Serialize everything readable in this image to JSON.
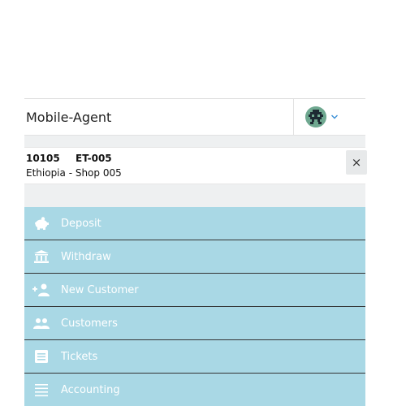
{
  "header": {
    "title": "Mobile-Agent"
  },
  "shop": {
    "code": "10105",
    "id": "ET-005",
    "name": "Ethiopia - Shop 005",
    "close_label": "×"
  },
  "menu": {
    "items": [
      {
        "label": "Deposit",
        "icon": "piggy-bank-icon"
      },
      {
        "label": "Withdraw",
        "icon": "bank-icon"
      },
      {
        "label": "New Customer",
        "icon": "add-user-icon"
      },
      {
        "label": "Customers",
        "icon": "users-icon"
      },
      {
        "label": "Tickets",
        "icon": "ticket-icon"
      },
      {
        "label": "Accounting",
        "icon": "list-icon"
      }
    ]
  },
  "colors": {
    "menu_bg": "#a9d8e5",
    "menu_text": "#ffffff",
    "divider": "#333333",
    "avatar": "#6fa890"
  }
}
